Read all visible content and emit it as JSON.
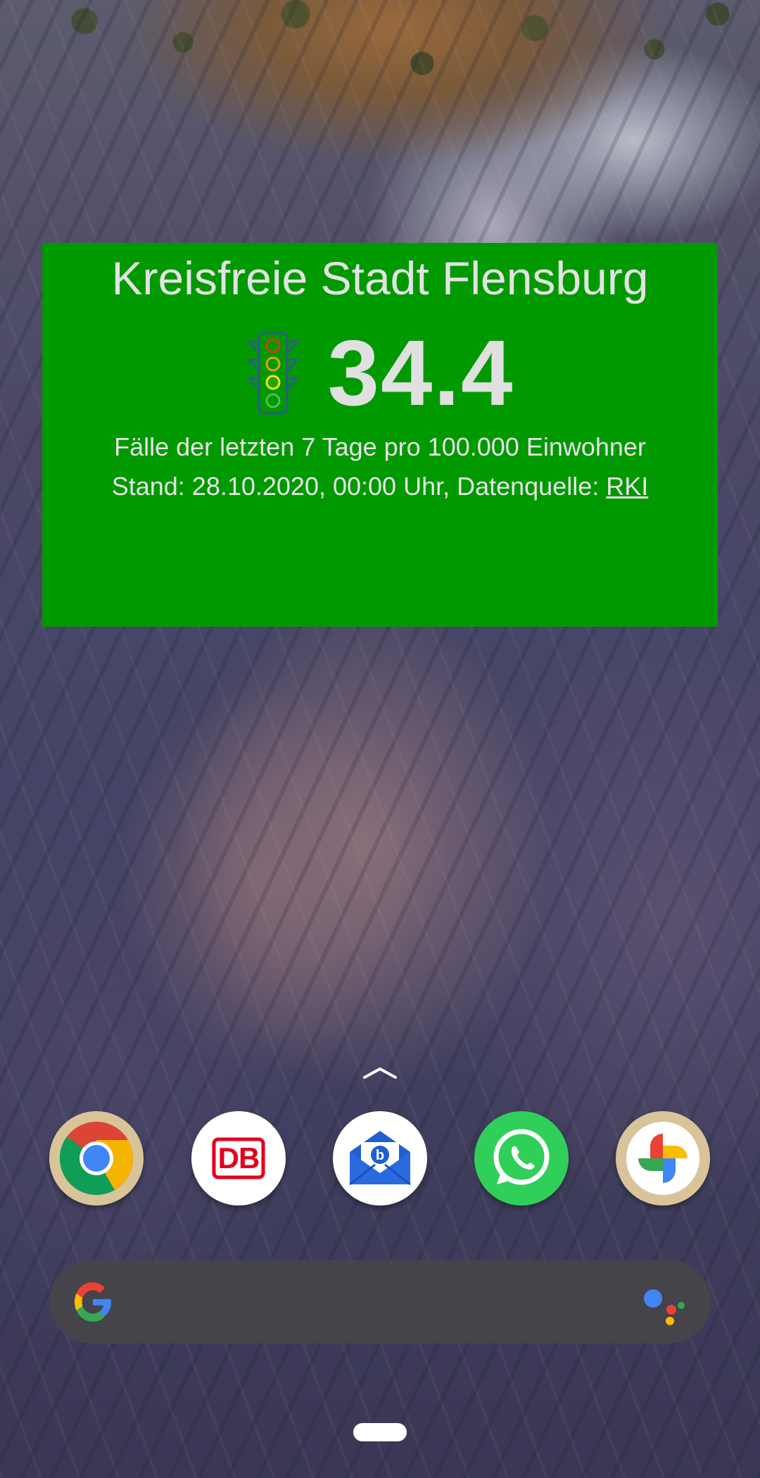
{
  "widget": {
    "title": "Kreisfreie Stadt Flensburg",
    "incidence": "34.4",
    "description": "Fälle der letzten 7 Tage pro 100.000 Einwohner",
    "stand_prefix": "Stand: 28.10.2020, 00:00 Uhr, Datenquelle: ",
    "source_link": "RKI",
    "background_color": "#009900",
    "traffic_light_icon": "traffic-light-icon"
  },
  "dock": {
    "apps": [
      {
        "name": "Chrome",
        "icon": "chrome-icon"
      },
      {
        "name": "DB",
        "icon": "db-icon"
      },
      {
        "name": "Mail",
        "icon": "mail-icon"
      },
      {
        "name": "WhatsApp",
        "icon": "whatsapp-icon"
      },
      {
        "name": "Photos",
        "icon": "photos-icon"
      }
    ],
    "db_label": "DB"
  },
  "search_bar": {
    "logo": "google-g-icon",
    "assistant": "google-assistant-icon"
  },
  "colors": {
    "widget_green": "#009900",
    "whatsapp_green": "#2fcf5a",
    "db_red": "#e3001b",
    "mail_blue": "#1f5fd1"
  }
}
